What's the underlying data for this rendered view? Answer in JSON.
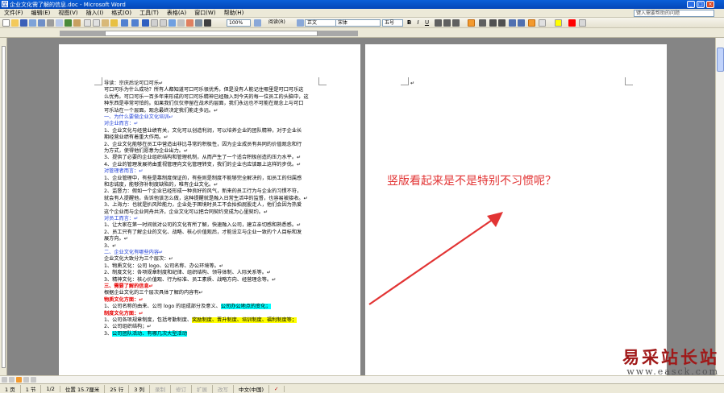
{
  "window": {
    "title": "企业文化需了解的信息.doc - Microsoft Word"
  },
  "menubar": {
    "items": [
      "文件(F)",
      "编辑(E)",
      "视图(V)",
      "插入(I)",
      "格式(O)",
      "工具(T)",
      "表格(A)",
      "窗口(W)",
      "帮助(H)"
    ],
    "help_placeholder": "键入需要帮助的问题"
  },
  "toolbar": {
    "zoom": "100%",
    "read_label": "阅读(R)",
    "style": "正文",
    "font_name": "宋体",
    "font_size": "五号",
    "bold": "B",
    "italic": "I",
    "underline": "U"
  },
  "document": {
    "page1_lines": [
      {
        "text": "导读：宗庆后论可口可乐↵",
        "cls": ""
      },
      {
        "text": "可口可乐为什么成功？所有人都知道可口可乐很优秀，但是没有人能记住哪里是可口可乐这",
        "cls": ""
      },
      {
        "text": "么优秀。可口可乐一百多年来形成的可口可乐精神已经融入到今天的每一位员工的头脑中，这",
        "cls": ""
      },
      {
        "text": "种东西是非常可怕的。如果我们仅仅停留在战术的层面，我们永远也不可能在观念上与可口",
        "cls": ""
      },
      {
        "text": "可乐站在一个层面。观念最终决定我们能走多远。↵",
        "cls": ""
      },
      {
        "text": "一、为什么要做企业文化培训↵",
        "cls": "blue"
      },
      {
        "text": "对企业而言：↵",
        "cls": "blue"
      },
      {
        "text": "1、企业文化与经营业绩有关，文化可以创造利润，可以培养企业的团队精神，对于企业长",
        "cls": ""
      },
      {
        "text": "期经营业绩有着重大作用。↵",
        "cls": ""
      },
      {
        "text": "2、企业文化能够在员工中营造出非比寻常的积极性，因为企业成员有共同的价值观念和行",
        "cls": ""
      },
      {
        "text": "为方式，使得他们愿意为企业出力。↵",
        "cls": ""
      },
      {
        "text": "3、提供了必要的企业组织结构和管理机制，从而产生了一个适合积极创造的压力水平。↵",
        "cls": ""
      },
      {
        "text": "4、企业的管理发展将由重视管理向文化管理转变，我们的企业也应该跟上这样的步伐。↵",
        "cls": ""
      },
      {
        "text": "对管理者而言：↵",
        "cls": "blue"
      },
      {
        "text": "1、企业管理中，有些是靠制度保证的，有些则是制度不能够完全解决的，如员工的归属感",
        "cls": ""
      },
      {
        "text": "和忠诚度，能够弥补制度缺陷的，唯有企业文化。↵",
        "cls": ""
      },
      {
        "text": "2、监督力：假如一个企业已经形成一种良好的风气，新来的员工行为与企业的习惯不符，",
        "cls": ""
      },
      {
        "text": "就会有人提醒他，告诉他该怎么做，这种提醒就是融入日常生活中的监督，也容易被接收。↵",
        "cls": ""
      },
      {
        "text": "3、上海力：也就是扒风险能力，企业处于困境时员工不会抬拍屁股走人，他们会因为热爱",
        "cls": ""
      },
      {
        "text": "这个企业而与企业同舟共济。企业文化可以把合同契约变成为心里契约。↵",
        "cls": ""
      },
      {
        "text": "对员工而言：↵",
        "cls": "blue"
      },
      {
        "text": "1、让大家在第一时间就对公司的文化有所了解，快速融入公司，建立亲切感和熟悉感。↵",
        "cls": ""
      },
      {
        "text": "2、员工只有了解企业的文化、战略、核心价值观后，才能设立与企业一致的个人目标和发",
        "cls": ""
      },
      {
        "text": "展方向。↵",
        "cls": ""
      },
      {
        "text": "3、↵",
        "cls": ""
      },
      {
        "text": "二、企业文化有哪些内容↵",
        "cls": "blue"
      },
      {
        "text": "企业文化大致分为三个层次：↵",
        "cls": ""
      },
      {
        "text": "1、物质文化：公司 logo、公司名称、办公环境等。↵",
        "cls": ""
      },
      {
        "text": "2、制度文化：各项规章制度和纪律、组织结构、领导体制、人际关系等。↵",
        "cls": ""
      },
      {
        "text": "3、精神文化：核心价值观、行为标准、员工素质、战略方向、经营理念等。↵",
        "cls": ""
      },
      {
        "text": "三、需要了解的信息↵",
        "cls": "red"
      },
      {
        "text": "根据企业文化的三个层次具体了解的内容有↵",
        "cls": ""
      },
      {
        "text": "物质文化方面：↵",
        "cls": "red"
      },
      {
        "text": "1、公司名称的由来、公司 logo 的组成部分及意义、",
        "cls": "",
        "hl": "公司办公地点的变化；",
        "hlcls": "hl-cyan"
      },
      {
        "text": "制度文化方面：↵",
        "cls": "red"
      },
      {
        "text": "1、公司各项规章制度，包括考勤制度、",
        "cls": "",
        "hl": "奖励制度、晋升制度、培训制度、福利制度等；",
        "hlcls": "hl-yellow"
      },
      {
        "text": "2、公司组织结构；↵",
        "cls": ""
      },
      {
        "text": "3、",
        "cls": "",
        "hl": "公司团队活动、有哪几次大型活动",
        "hlcls": "hl-cyan"
      }
    ],
    "page2_mark": "↵"
  },
  "annotation": {
    "text": "竖版看起来是不是特别不习惯呢？"
  },
  "statusbar": {
    "page": "1 页",
    "section": "1 节",
    "pages": "1/2",
    "position": "位置 15.7厘米",
    "line": "25 行",
    "col": "3 列",
    "rec": "录制",
    "trk": "修订",
    "ext": "扩展",
    "ovr": "改写",
    "lang": "中文(中国)"
  },
  "watermark": {
    "title": "易采站长站",
    "url": "www.easck.com"
  },
  "colors": {
    "accent": "#e23434",
    "title_bar": "#0a5fd8"
  }
}
